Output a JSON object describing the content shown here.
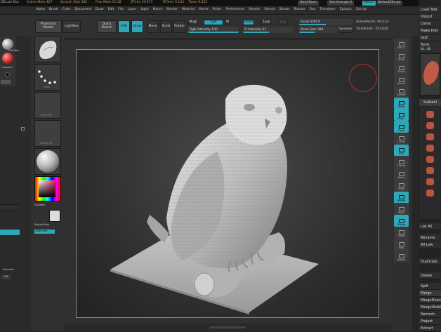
{
  "titlebar": {
    "items": [
      "ZBrush Doc",
      "Active Mem 427",
      "Scratch Disk 282",
      "Free Mem 15.18",
      "ZTime 19.877",
      "RTimer 0.145",
      "Timer 0.023"
    ],
    "quicksave": "QuickSave",
    "see_through": "See-through 0",
    "menus": "Menus",
    "default_script": "DefaultZScript"
  },
  "menubar": {
    "items": [
      "Alpha",
      "Brush",
      "Color",
      "Document",
      "Draw",
      "Edit",
      "File",
      "Layer",
      "Light",
      "Macro",
      "Marker",
      "Material",
      "Movie",
      "Picker",
      "Preferences",
      "Render",
      "Stencil",
      "Stroke",
      "Texture",
      "Tool",
      "Transform",
      "Zplugin",
      "Zscript"
    ]
  },
  "topshelf": {
    "projection_master": "Projection Master",
    "lightbox": "LightBox",
    "quick_sketch": "Quick Sketch",
    "edit": "Edit",
    "draw": "Draw",
    "move": "Move",
    "scale": "Scale",
    "rotate": "Rotate",
    "mrgb": "Mrgb",
    "rgb": "Rgb",
    "m": "M",
    "zadd": "Zadd",
    "zsub": "Zsub",
    "zcut": "Zcut",
    "rgb_intensity": "Rgb Intensity 100",
    "z_intensity": "Z Intensity 51",
    "focal_shift": "Focal Shift 0",
    "draw_size": "Draw Size 384",
    "dynamic": "Dynamic",
    "active_points": "ActivePoints: 96,533",
    "total_points": "TotalPoints: 351,620"
  },
  "leftpal": {
    "labels": [
      "Flat Wax",
      "Crease 4",
      "Gradient",
      "SwitchColor",
      "Alternate",
      "Selected",
      "Off"
    ]
  },
  "lefttray": {
    "labels": [
      "Dots",
      "Alpha Off",
      "Texture Off",
      "Gradient",
      "SwitchColor",
      "Alternate"
    ]
  },
  "rightshelf": {
    "buttons": [
      "SPix 3",
      "Scroll",
      "Zoom",
      "Actual",
      "AAHalf",
      "Persp",
      "Floor",
      "Local",
      "L.Sym",
      "XYZ",
      "Frame",
      "Move",
      "Scale",
      "Rotate",
      "PolyF",
      "Transp",
      "Ghost",
      "Solo",
      "Xpose"
    ]
  },
  "rightpal": {
    "top": [
      "Load Tool",
      "Import",
      "Clone",
      "Make Poly",
      "GoZ",
      "Lightbox",
      "Tools",
      "AL. 48"
    ],
    "subtool": "Subtool",
    "list": [
      "List All",
      "Rename",
      "All Low",
      "Duplicate",
      "Delete",
      "Split",
      "Merge",
      "MergeDown",
      "MergeVisible",
      "Remesh",
      "Project",
      "Extract"
    ]
  },
  "accent": "#2ea7b8"
}
